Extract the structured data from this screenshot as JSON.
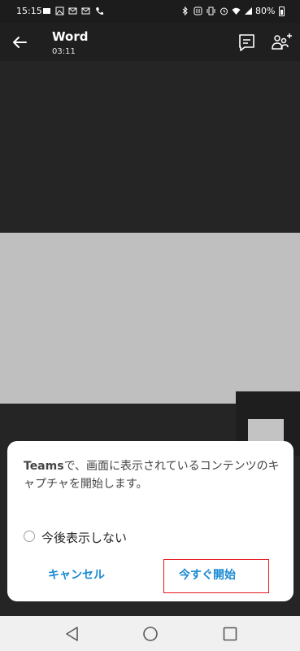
{
  "status_bar": {
    "time": "15:15",
    "battery": "80%"
  },
  "header": {
    "title": "Word",
    "subtitle": "03:11"
  },
  "dialog": {
    "message_app": "Teams",
    "message_rest": "で、画面に表示されているコンテンツのキャプチャを開始します。",
    "dont_show_label": "今後表示しない",
    "cancel_label": "キャンセル",
    "start_label": "今すぐ開始"
  },
  "colors": {
    "accent": "#1a8ad2",
    "highlight": "#e4161d"
  },
  "icons": {
    "back": "arrow-left-icon",
    "chat": "chat-icon",
    "add_people": "add-people-icon",
    "nav_back": "triangle-back-icon",
    "nav_home": "circle-home-icon",
    "nav_recents": "square-recents-icon"
  }
}
